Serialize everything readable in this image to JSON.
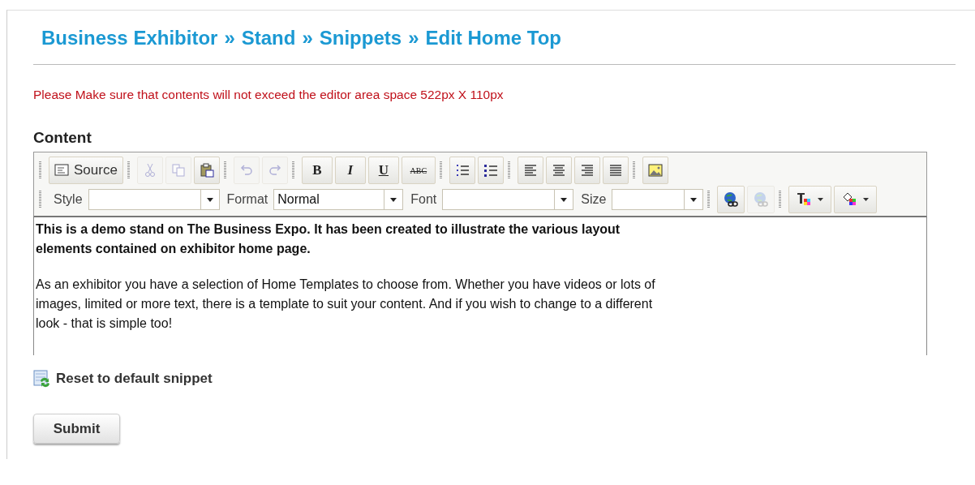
{
  "breadcrumb": {
    "separator": "»",
    "items": [
      "Business Exhibitor",
      "Stand",
      "Snippets",
      "Edit Home Top"
    ]
  },
  "warning": "Please Make sure that contents will not exceed the editor area space 522px X 110px",
  "content_label": "Content",
  "toolbar": {
    "row1": [
      [
        {
          "kind": "source",
          "label": "Source",
          "disabled": false
        }
      ],
      [
        {
          "kind": "cut",
          "disabled": true
        },
        {
          "kind": "copy",
          "disabled": true
        },
        {
          "kind": "paste",
          "disabled": false
        }
      ],
      [
        {
          "kind": "undo",
          "disabled": true
        },
        {
          "kind": "redo",
          "disabled": true
        }
      ],
      [
        {
          "kind": "bold",
          "label": "B",
          "disabled": false
        },
        {
          "kind": "italic",
          "label": "I",
          "disabled": false
        },
        {
          "kind": "underline",
          "label": "U",
          "disabled": false
        },
        {
          "kind": "strike",
          "label": "ABC",
          "disabled": false
        }
      ],
      [
        {
          "kind": "ol",
          "disabled": false
        },
        {
          "kind": "ul",
          "disabled": false
        }
      ],
      [
        {
          "kind": "align-left",
          "disabled": false
        },
        {
          "kind": "align-center",
          "disabled": false
        },
        {
          "kind": "align-right",
          "disabled": false
        },
        {
          "kind": "justify",
          "disabled": false
        }
      ],
      [
        {
          "kind": "image",
          "disabled": false
        }
      ]
    ],
    "combos": [
      {
        "label": "Style"
      },
      {
        "label": "Format",
        "value": "Normal"
      },
      {
        "label": "Font"
      },
      {
        "label": "Size"
      }
    ],
    "row2": [
      [
        {
          "kind": "link",
          "disabled": false
        },
        {
          "kind": "unlink",
          "disabled": true
        }
      ],
      [
        {
          "kind": "text-color",
          "disabled": false
        },
        {
          "kind": "bg-color",
          "disabled": false
        }
      ]
    ]
  },
  "editor": {
    "paragraphs": [
      {
        "bold": true,
        "text": "This is a demo stand on The Business Expo. It has been created to illustrate the various layout elements contained on exhibitor home page."
      },
      {
        "bold": false,
        "text": "As an exhibitor you have a selection of Home Templates to choose from. Whether you have videos or lots of images, limited or more text, there is a template to suit your content. And if you wish to change to a different look - that is simple too!"
      }
    ]
  },
  "reset_link": "Reset to default snippet",
  "submit": "Submit"
}
